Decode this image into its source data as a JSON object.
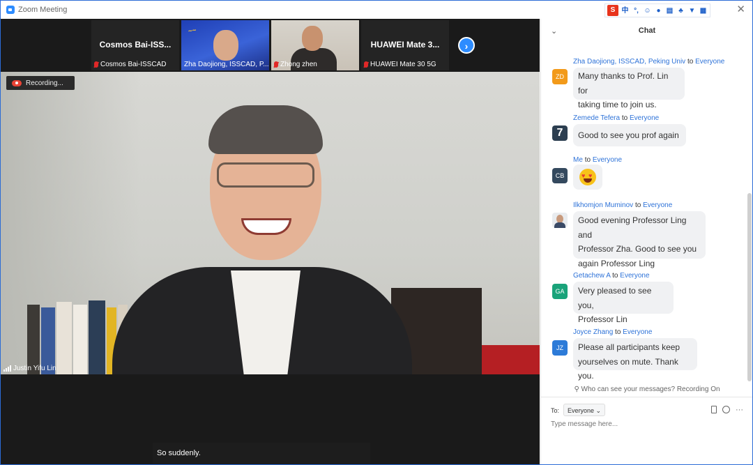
{
  "window": {
    "title": "Zoom Meeting"
  },
  "filmstrip": [
    {
      "name": "Cosmos Bai-ISS...",
      "label": "Cosmos Bai-ISSCAD",
      "muted": true
    },
    {
      "name": "",
      "label": "Zha Daojiong, ISSCAD, P...",
      "muted": false
    },
    {
      "name": "",
      "label": "Zhong zhen",
      "muted": true
    },
    {
      "name": "HUAWEI Mate 3...",
      "label": "HUAWEI Mate 30 5G",
      "muted": true
    }
  ],
  "recording": {
    "label": "Recording..."
  },
  "active_speaker": {
    "name": "Justin Yifu Lin"
  },
  "caption": "So suddenly.",
  "chat": {
    "title": "Chat",
    "messages": [
      {
        "sender": "Zha Daojiong, ISSCAD, Peking Univ",
        "to": "to",
        "recipient": "Everyone",
        "avatar": "ZD",
        "avatar_color": "#f29a1a",
        "text_lines": [
          "Many thanks to Prof. Lin for",
          "taking time to join us."
        ]
      },
      {
        "sender": "Zemede Tefera",
        "to": "to",
        "recipient": "Everyone",
        "avatar": "7",
        "avatar_color": "#2c3e50",
        "text_lines": [
          "Good to see you prof again"
        ]
      },
      {
        "sender": "Me",
        "to": "to",
        "recipient": "Everyone",
        "avatar": "CB",
        "avatar_color": "#34495e",
        "text_lines": [],
        "emoji": "heart-eyes"
      },
      {
        "sender": "Ilkhomjon Muminov",
        "to": "to",
        "recipient": "Everyone",
        "avatar": "",
        "avatar_color": "#e9ecef",
        "text_lines": [
          "Good evening Professor Ling and",
          "Professor Zha. Good to see you",
          "again Professor Ling"
        ]
      },
      {
        "sender": "Getachew A",
        "to": "to",
        "recipient": "Everyone",
        "avatar": "GA",
        "avatar_color": "#1aa37a",
        "text_lines": [
          "Very pleased to see you,",
          "Professor Lin"
        ]
      },
      {
        "sender": "Joyce Zhang",
        "to": "to",
        "recipient": "Everyone",
        "avatar": "JZ",
        "avatar_color": "#2d7bd8",
        "text_lines": [
          "Please all participants keep",
          "yourselves on mute. Thank you."
        ]
      }
    ],
    "visibility_notice": "Who can see your messages? Recording On",
    "to_label": "To:",
    "to_value": "Everyone",
    "input_placeholder": "Type message here..."
  },
  "colors": {
    "accent": "#2d8cff",
    "chat_link": "#2d72d8",
    "recording_red": "#ea4335"
  }
}
